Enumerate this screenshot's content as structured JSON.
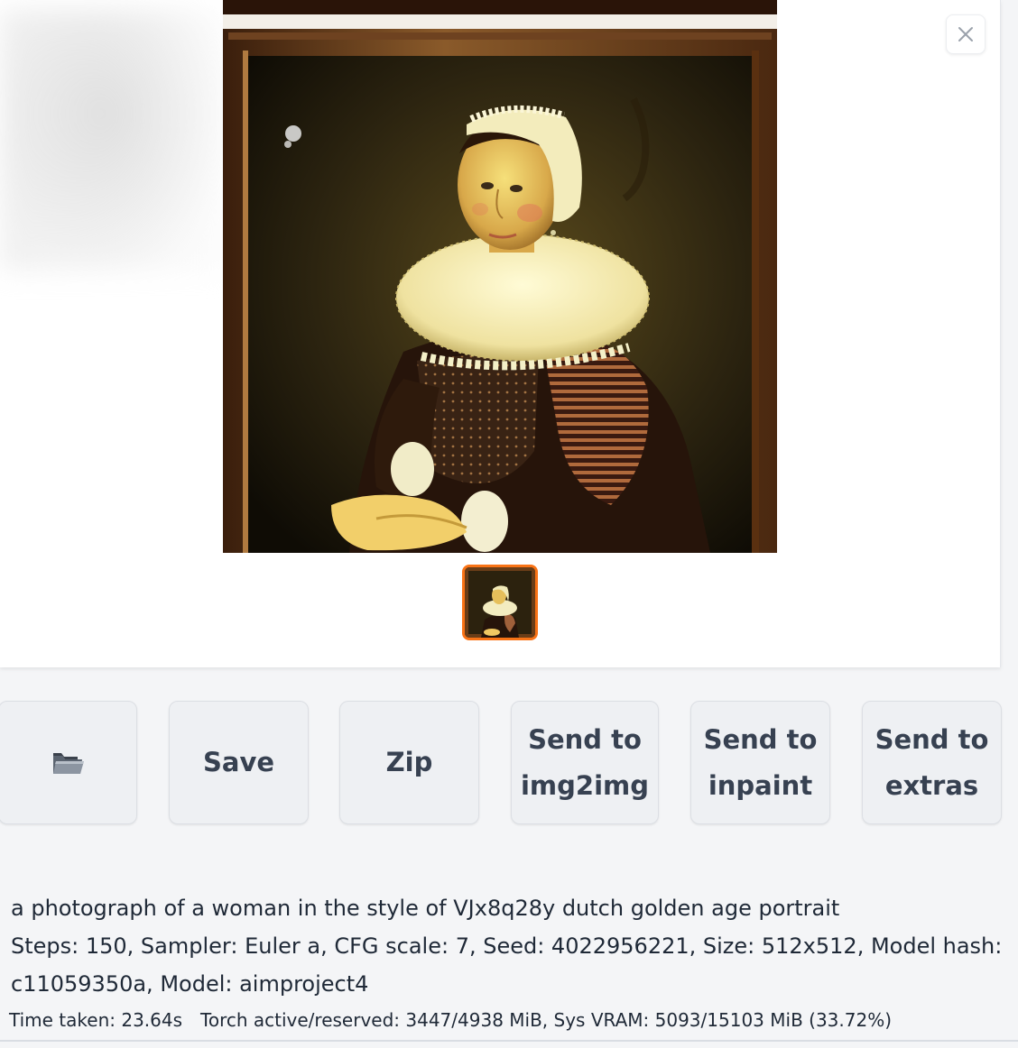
{
  "gallery": {
    "close_icon": "close-icon",
    "main_image_alt": "portrait of a woman in dutch golden age style",
    "accent_color": "#f97316"
  },
  "buttons": {
    "open_folder_icon": "folder-icon",
    "save_label": "Save",
    "zip_label": "Zip",
    "send_img2img": [
      "Send to",
      "img2img"
    ],
    "send_inpaint": [
      "Send to",
      "inpaint"
    ],
    "send_extras": [
      "Send to",
      "extras"
    ]
  },
  "info": {
    "prompt": "a photograph of a woman in the style of VJx8q28y dutch golden age portrait",
    "params": "Steps: 150, Sampler: Euler a, CFG scale: 7, Seed: 4022956221, Size: 512x512, Model hash: c11059350a, Model: aimproject4",
    "timing": "Time taken: 23.64s Torch active/reserved: 3447/4938 MiB, Sys VRAM: 5093/15103 MiB (33.72%)"
  }
}
